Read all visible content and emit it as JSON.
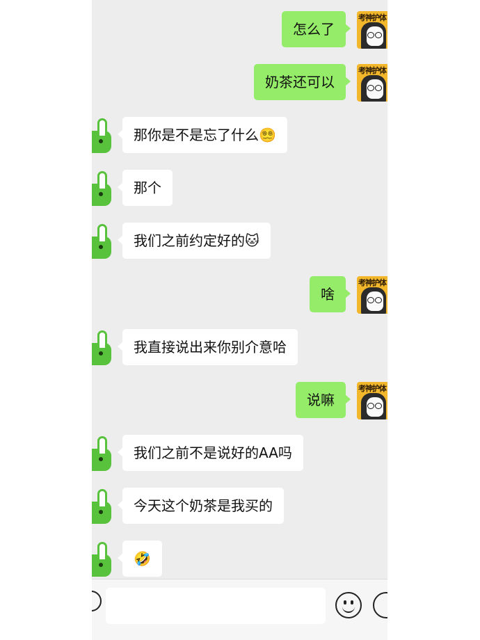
{
  "messages": [
    {
      "side": "right",
      "text": "怎么了"
    },
    {
      "side": "right",
      "text": "奶茶还可以"
    },
    {
      "side": "left",
      "text": "那你是不是忘了什么",
      "emoji": "😵‍💫"
    },
    {
      "side": "left",
      "text": "那个"
    },
    {
      "side": "left",
      "text": "我们之前约定好的",
      "emoji": "🐱"
    },
    {
      "side": "right",
      "text": "啥"
    },
    {
      "side": "left",
      "text": "我直接说出来你别介意哈"
    },
    {
      "side": "right",
      "text": "说嘛"
    },
    {
      "side": "left",
      "text": "我们之前不是说好的AA吗"
    },
    {
      "side": "left",
      "text": "今天这个奶茶是我买的"
    },
    {
      "side": "left",
      "text": "",
      "emoji": "🤣"
    }
  ],
  "avatar_right_text": "考神护体",
  "colors": {
    "bg": "#ededed",
    "bubble_out": "#95ec69",
    "bubble_in": "#ffffff",
    "avatar_left": "#58c23c",
    "avatar_right": "#f2b72a"
  },
  "input_bar": {
    "voice_icon": "voice-icon",
    "emoji_icon": "emoji-icon",
    "plus_icon": "plus-icon"
  }
}
